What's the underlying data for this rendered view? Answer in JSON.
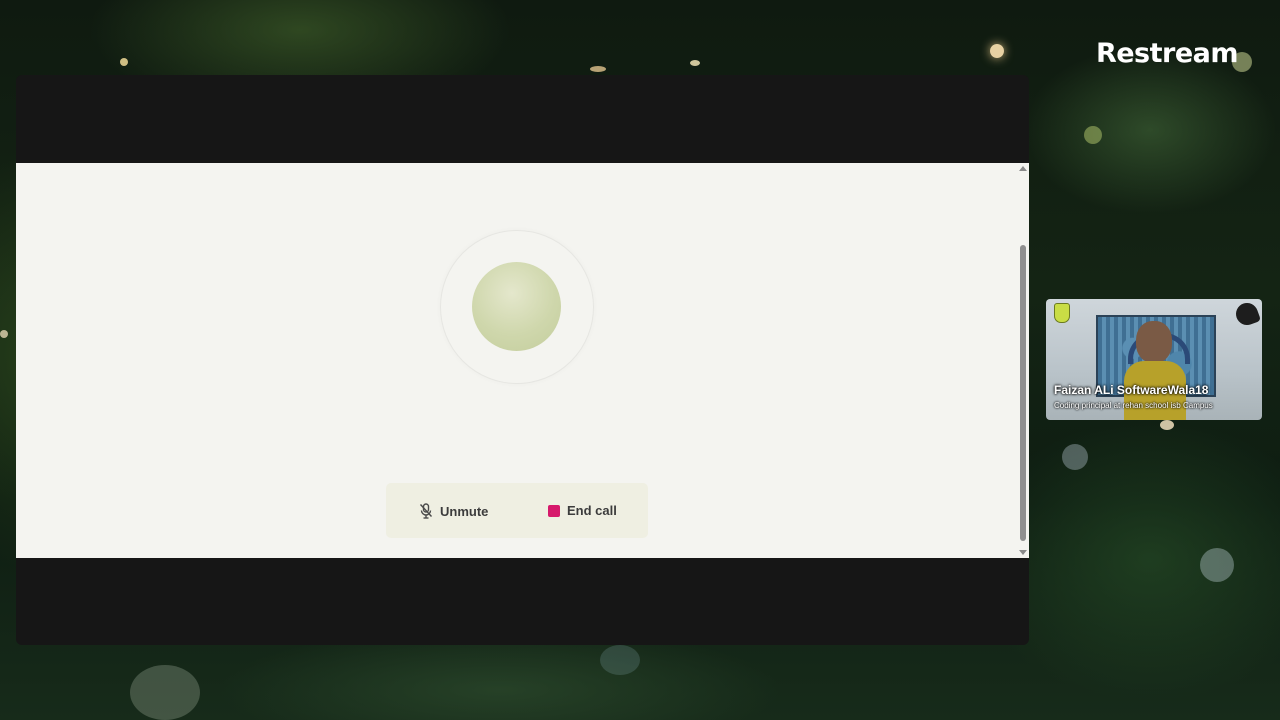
{
  "brand": {
    "name": "Restream"
  },
  "call": {
    "controls": {
      "unmute_label": "Unmute",
      "end_call_label": "End call"
    },
    "colors": {
      "end_call_icon": "#d6196b",
      "avatar": "#cfd7ac",
      "control_bar": "#efefe2",
      "content_bg": "#f4f4f0"
    },
    "icons": {
      "unmute": "microphone-off-icon",
      "end_call": "stop-square-icon"
    }
  },
  "participant": {
    "name": "Faizan ALi SoftwareWala18",
    "title": "Coding principal at rehan school isb Campus"
  }
}
